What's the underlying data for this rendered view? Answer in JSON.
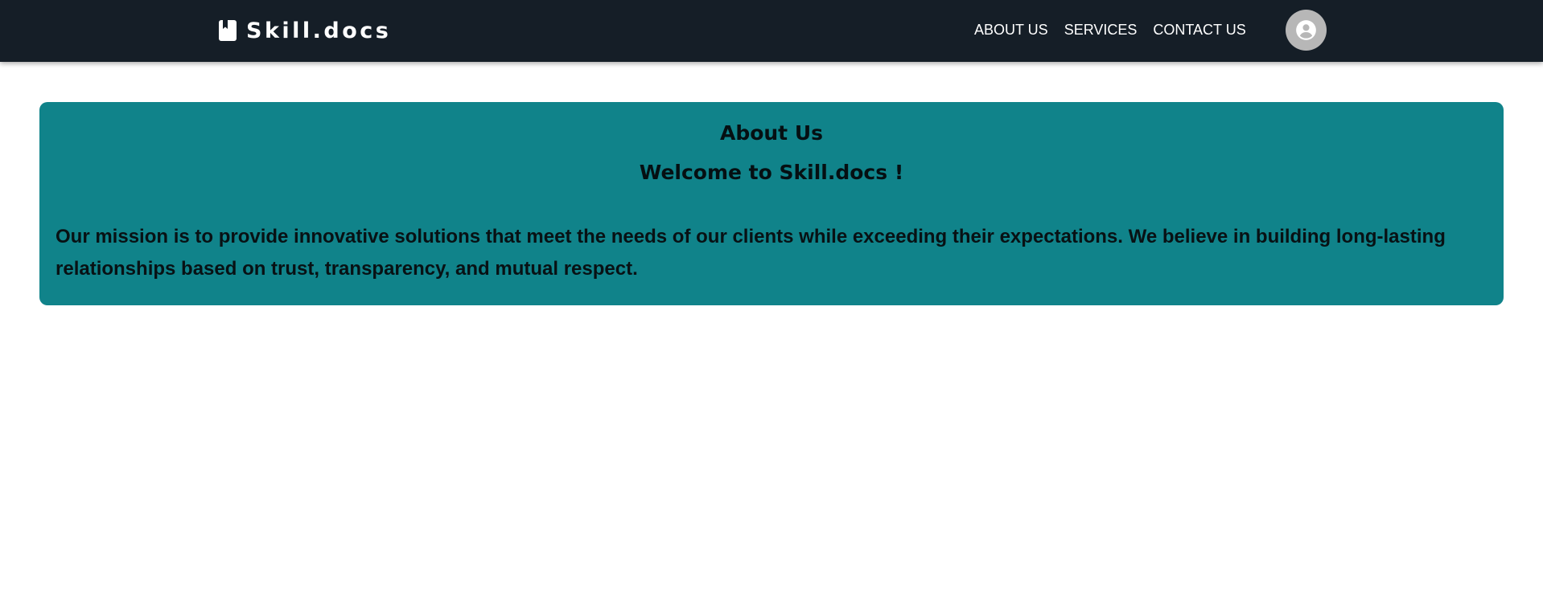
{
  "navbar": {
    "brand": {
      "icon": "book-bookmark-icon",
      "name": "Skill.docs"
    },
    "links": [
      {
        "label": "ABOUT US"
      },
      {
        "label": "SERVICES"
      },
      {
        "label": "CONTACT US"
      }
    ],
    "avatar_icon": "user-circle-icon",
    "colors": {
      "background": "#151e27",
      "text": "#ffffff",
      "avatar": "#b7b7b7"
    }
  },
  "about": {
    "title": "About Us",
    "welcome": "Welcome to Skill.docs !",
    "mission": "Our mission is to provide innovative solutions that meet the needs of our clients while exceeding their expectations. We believe in building long-lasting relationships based on trust, transparency, and mutual respect.",
    "colors": {
      "background": "#10838a",
      "text": "#050f12"
    }
  }
}
